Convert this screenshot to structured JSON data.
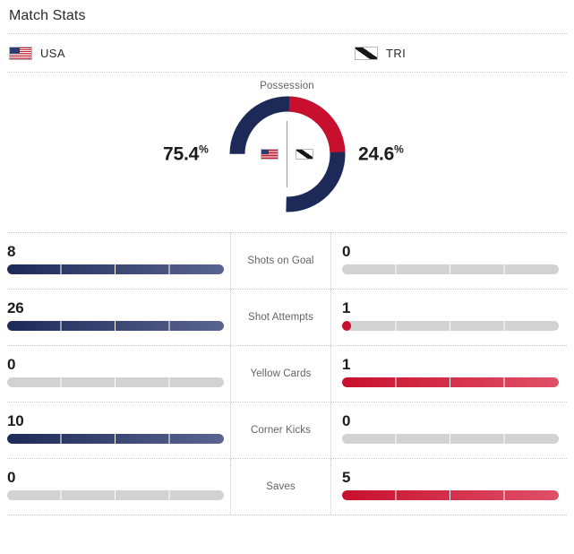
{
  "header": {
    "title": "Match Stats"
  },
  "teams": {
    "home": {
      "abbr": "USA",
      "flag_icon": "usa-flag-icon",
      "color": "#1d2a57"
    },
    "away": {
      "abbr": "TRI",
      "flag_icon": "trinidad-tobago-flag-icon",
      "color": "#c8102e"
    }
  },
  "possession": {
    "label": "Possession",
    "home_pct": "75.4",
    "away_pct": "24.6",
    "pct_symbol": "%"
  },
  "stats": [
    {
      "label": "Shots on Goal",
      "home": "8",
      "away": "0",
      "home_fill": 100,
      "away_fill": 0
    },
    {
      "label": "Shot Attempts",
      "home": "26",
      "away": "1",
      "home_fill": 100,
      "away_fill": 4
    },
    {
      "label": "Yellow Cards",
      "home": "0",
      "away": "1",
      "home_fill": 0,
      "away_fill": 100
    },
    {
      "label": "Corner Kicks",
      "home": "10",
      "away": "0",
      "home_fill": 100,
      "away_fill": 0
    },
    {
      "label": "Saves",
      "home": "0",
      "away": "5",
      "home_fill": 0,
      "away_fill": 100
    }
  ],
  "chart_data": {
    "type": "pie",
    "title": "Possession",
    "labels": [
      "USA",
      "TRI"
    ],
    "values": [
      75.4,
      24.6
    ],
    "unit": "%",
    "colors": [
      "#1d2a57",
      "#c8102e"
    ],
    "legend": "inline-flags",
    "start_angle_deg": 0,
    "donut_hole_ratio": 0.66
  }
}
